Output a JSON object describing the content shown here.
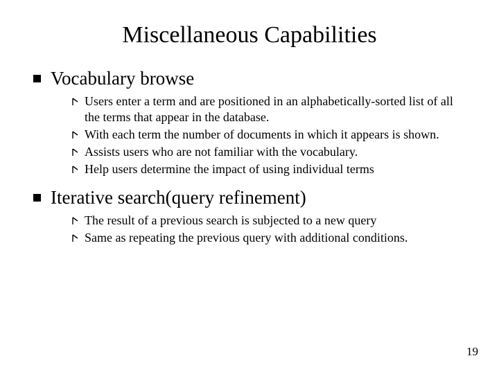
{
  "title": "Miscellaneous Capabilities",
  "sections": [
    {
      "title": "Vocabulary browse",
      "items": [
        "Users enter a term and are positioned in an alphabetically-sorted list of all the terms that appear in the database.",
        "With each term the number of documents in which it appears is shown.",
        "Assists users who are not familiar with the vocabulary.",
        "Help users determine the impact of using individual terms"
      ]
    },
    {
      "title": "Iterative search(query refinement)",
      "items": [
        "The result of a previous search is subjected to a new query",
        "Same as repeating the previous query with additional conditions."
      ]
    }
  ],
  "page_number": "19"
}
